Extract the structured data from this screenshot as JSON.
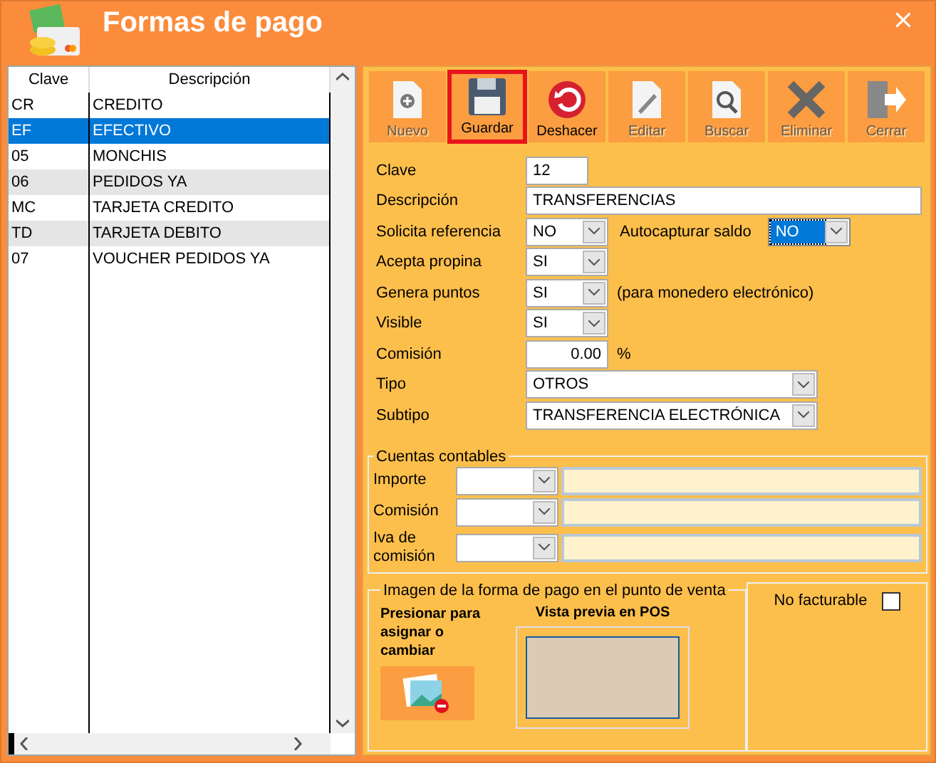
{
  "window": {
    "title": "Formas de pago"
  },
  "table": {
    "columns": [
      "Clave",
      "Descripción"
    ],
    "rows": [
      {
        "cells": [
          "CR",
          "CREDITO"
        ],
        "selected": false,
        "shaded": false
      },
      {
        "cells": [
          "EF",
          "EFECTIVO"
        ],
        "selected": true,
        "shaded": false
      },
      {
        "cells": [
          "05",
          "MONCHIS"
        ],
        "selected": false,
        "shaded": false
      },
      {
        "cells": [
          "06",
          "PEDIDOS YA"
        ],
        "selected": false,
        "shaded": true
      },
      {
        "cells": [
          "MC",
          "TARJETA CREDITO"
        ],
        "selected": false,
        "shaded": false
      },
      {
        "cells": [
          "TD",
          "TARJETA DEBITO"
        ],
        "selected": false,
        "shaded": true
      },
      {
        "cells": [
          "07",
          "VOUCHER PEDIDOS YA"
        ],
        "selected": false,
        "shaded": false
      }
    ]
  },
  "toolbar": [
    {
      "label": "Nuevo",
      "highlighted": false,
      "disabled": true
    },
    {
      "label": "Guardar",
      "highlighted": true,
      "disabled": false
    },
    {
      "label": "Deshacer",
      "highlighted": false,
      "disabled": false
    },
    {
      "label": "Editar",
      "highlighted": false,
      "disabled": true
    },
    {
      "label": "Buscar",
      "highlighted": false,
      "disabled": true
    },
    {
      "label": "Eliminar",
      "highlighted": false,
      "disabled": true
    },
    {
      "label": "Cerrar",
      "highlighted": false,
      "disabled": true
    }
  ],
  "form": [
    {
      "label": "Clave",
      "kind": "text",
      "value": "12"
    },
    {
      "label": "Descripción",
      "kind": "wide-text",
      "value": "TRANSFERENCIAS"
    },
    {
      "label": "Solicita referencia",
      "kind": "select",
      "value": "NO",
      "extra": {
        "label": "Autocapturar saldo",
        "value": "NO",
        "focused": true
      }
    },
    {
      "label": "Acepta propina",
      "kind": "select",
      "value": "SI"
    },
    {
      "label": "Genera puntos",
      "kind": "select",
      "value": "SI",
      "note": "(para monedero electrónico)"
    },
    {
      "label": "Visible",
      "kind": "select",
      "value": "SI"
    },
    {
      "label": "Comisión",
      "kind": "number",
      "value": "0.00",
      "note": "%"
    },
    {
      "label": "Tipo",
      "kind": "wide-select",
      "value": "OTROS"
    },
    {
      "label": "Subtipo",
      "kind": "wide-select",
      "value": "TRANSFERENCIA ELECTRÓNICA"
    }
  ],
  "accounts": {
    "title": "Cuentas contables",
    "rows": [
      {
        "label": "Importe"
      },
      {
        "label": "Comisión"
      },
      {
        "label": "Iva de comisión"
      }
    ]
  },
  "image_section": {
    "title": "Imagen de la forma de pago en el punto de venta",
    "hint": "Presionar para asignar o cambiar",
    "preview_label": "Vista previa en POS"
  },
  "no_facturable": {
    "label": "No facturable",
    "checked": false
  }
}
